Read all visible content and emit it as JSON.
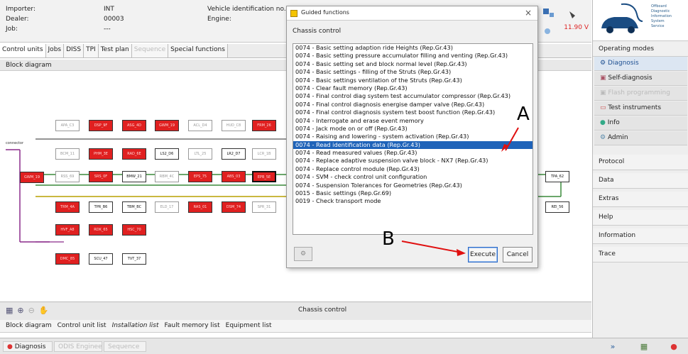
{
  "header": {
    "labels": [
      "Importer:",
      "Dealer:",
      "Job:"
    ],
    "values": [
      "INT",
      "00003",
      "---"
    ],
    "vin_label": "Vehicle identification no.:",
    "engine_label": "Engine:",
    "voltage": "11.90 V"
  },
  "tabs": [
    {
      "label": "Control units",
      "state": "active"
    },
    {
      "label": "Jobs",
      "state": "normal"
    },
    {
      "label": "DISS",
      "state": "normal"
    },
    {
      "label": "TPI",
      "state": "normal"
    },
    {
      "label": "Test plan",
      "state": "normal"
    },
    {
      "label": "Sequence",
      "state": "disabled"
    },
    {
      "label": "Special functions",
      "state": "normal"
    }
  ],
  "main": {
    "section_title": "Block diagram",
    "connector_label": "connector",
    "footer_label": "Chassis control"
  },
  "nodes": [
    {
      "label": "APA_C3",
      "style": "grey"
    },
    {
      "label": "DSP_9F",
      "style": "red"
    },
    {
      "label": "ASG_4D",
      "style": "red"
    },
    {
      "label": "GWM_19",
      "style": "red"
    },
    {
      "label": "ACL_D4",
      "style": "grey"
    },
    {
      "label": "HUD_C8",
      "style": "grey"
    },
    {
      "label": "FRM_26",
      "style": "red"
    },
    {
      "label": "BCM_11",
      "style": "grey"
    },
    {
      "label": "PHM_3E",
      "style": "red"
    },
    {
      "label": "RAD_6E",
      "style": "red"
    },
    {
      "label": "LS2_D6",
      "style": "active"
    },
    {
      "label": "LTL_25",
      "style": "grey"
    },
    {
      "label": "LR2_D7",
      "style": "active"
    },
    {
      "label": "LCR_1B",
      "style": "grey"
    },
    {
      "label": "GWM_10",
      "style": "red"
    },
    {
      "label": "RSS_69",
      "style": "grey"
    },
    {
      "label": "SRS_0F",
      "style": "red"
    },
    {
      "label": "BMW_21",
      "style": "active"
    },
    {
      "label": "RBM_4C",
      "style": "grey"
    },
    {
      "label": "EPS_75",
      "style": "red"
    },
    {
      "label": "ABS_03",
      "style": "red"
    },
    {
      "label": "EPB_5E",
      "style": "selected"
    },
    {
      "label": "TRM_4A",
      "style": "red"
    },
    {
      "label": "TPR_B6",
      "style": "active"
    },
    {
      "label": "TBM_BC",
      "style": "active"
    },
    {
      "label": "ELD_17",
      "style": "grey"
    },
    {
      "label": "RAS_01",
      "style": "red"
    },
    {
      "label": "DSM_74",
      "style": "red"
    },
    {
      "label": "SPR_31",
      "style": "grey"
    },
    {
      "label": "HVF_A8",
      "style": "red"
    },
    {
      "label": "RDK_65",
      "style": "red"
    },
    {
      "label": "HSC_70",
      "style": "red"
    },
    {
      "label": "DMC_85",
      "style": "red"
    },
    {
      "label": "SCU_47",
      "style": "active"
    },
    {
      "label": "TVT_37",
      "style": "active"
    },
    {
      "label": "TPA_62",
      "style": "active"
    },
    {
      "label": "REI_56",
      "style": "active"
    }
  ],
  "bottom_tabs": [
    {
      "label": "Block diagram",
      "italic": false
    },
    {
      "label": "Control unit list",
      "italic": false
    },
    {
      "label": "Installation list",
      "italic": true
    },
    {
      "label": "Fault memory list",
      "italic": false
    },
    {
      "label": "Equipment list",
      "italic": false
    }
  ],
  "statusbar": {
    "diagnosis": "Diagnosis",
    "item2": "ODIS Engineering",
    "item3": "Sequence"
  },
  "sidebar": {
    "logo_text": [
      "Offboard",
      "Diagnostic",
      "Information",
      "System",
      "Service"
    ],
    "operating_modes": "Operating modes",
    "items": [
      {
        "label": "Diagnosis",
        "state": "active"
      },
      {
        "label": "Self-diagnosis",
        "state": "normal"
      },
      {
        "label": "Flash programming",
        "state": "disabled"
      },
      {
        "label": "Test instruments",
        "state": "normal"
      },
      {
        "label": "Info",
        "state": "normal"
      },
      {
        "label": "Admin",
        "state": "normal"
      }
    ],
    "groups": [
      "Protocol",
      "Data",
      "Extras",
      "Help",
      "Information",
      "Trace"
    ]
  },
  "dialog": {
    "title": "Guided functions",
    "header": "Chassis control",
    "selected_index": 15,
    "items": [
      "0074 - Basic setting adaption ride Heights (Rep.Gr.43)",
      "0074 - Basic setting pressure accumulator filling and venting (Rep.Gr.43)",
      "0074 - Basic setting set and block normal level (Rep.Gr.43)",
      "0074 - Basic settings - filling of the Struts (Rep.Gr.43)",
      "0074 - Basic settings ventilation of the Struts (Rep.Gr.43)",
      "0074 - Clear fault memory (Rep.Gr.43)",
      "0074 - Final control diag system test accumulator compressor (Rep.Gr.43)",
      "0074 - Final control diagnosis energise damper valve (Rep.Gr.43)",
      "0074 - Final control diagnosis system test boost function (Rep.Gr.43)",
      "0074 - Interrogate and erase event memory",
      "0074 - Jack mode on or off (Rep.Gr.43)",
      "0074 - Raising and lowering - system activation (Rep.Gr.43)",
      "0074 - Read identification data (Rep.Gr.43)",
      "0074 - Read measured values (Rep.Gr.43)",
      "0074 - Replace adaptive suspension valve block - NX7 (Rep.Gr.43)",
      "0074 - Replace control module (Rep.Gr.43)",
      "0074 - SVM - check control unit configuration",
      "0074 - Suspension Tolerances for Geometries (Rep.Gr.43)",
      "0015 - Basic settings (Rep.Gr.69)",
      "0019 - Check transport mode"
    ],
    "execute": "Execute",
    "cancel": "Cancel"
  },
  "annotations": {
    "a": "A",
    "b": "B"
  }
}
